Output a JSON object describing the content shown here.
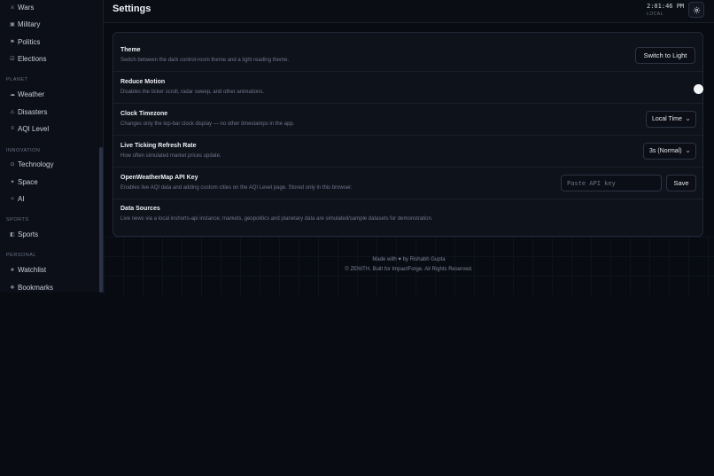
{
  "sidebar": {
    "items_top": [
      {
        "icon": "sword-icon",
        "glyph": "⚔",
        "label": "Wars"
      },
      {
        "icon": "military-icon",
        "glyph": "▣",
        "label": "Military"
      },
      {
        "icon": "flag-icon",
        "glyph": "⚑",
        "label": "Politics"
      },
      {
        "icon": "ballot-icon",
        "glyph": "☑",
        "label": "Elections"
      }
    ],
    "section_planet": "PLANET",
    "items_planet": [
      {
        "icon": "cloud-icon",
        "glyph": "☁",
        "label": "Weather"
      },
      {
        "icon": "warning-icon",
        "glyph": "⚠",
        "label": "Disasters"
      },
      {
        "icon": "wind-icon",
        "glyph": "≡",
        "label": "AQI Level"
      }
    ],
    "section_innovation": "INNOVATION",
    "items_innovation": [
      {
        "icon": "chip-icon",
        "glyph": "⊙",
        "label": "Technology"
      },
      {
        "icon": "rocket-icon",
        "glyph": "✦",
        "label": "Space"
      },
      {
        "icon": "sparkle-icon",
        "glyph": "✧",
        "label": "AI"
      }
    ],
    "section_sports": "SPORTS",
    "items_sports": [
      {
        "icon": "trophy-icon",
        "glyph": "◧",
        "label": "Sports"
      }
    ],
    "section_personal": "PERSONAL",
    "items_personal": [
      {
        "icon": "star-icon",
        "glyph": "★",
        "label": "Watchlist"
      },
      {
        "icon": "bookmark-icon",
        "glyph": "❖",
        "label": "Bookmarks"
      }
    ]
  },
  "header": {
    "title": "Settings",
    "clock": "2:01:46 PM",
    "clock_zone": "LOCAL",
    "settings_icon": "gear-icon"
  },
  "settings": {
    "theme": {
      "title": "Theme",
      "desc": "Switch between the dark control-room theme and a light reading theme.",
      "button": "Switch to Light"
    },
    "motion": {
      "title": "Reduce Motion",
      "desc": "Disables the ticker scroll, radar sweep, and other animations.",
      "enabled": false
    },
    "timezone": {
      "title": "Clock Timezone",
      "desc": "Changes only the top-bar clock display — no other timestamps in the app.",
      "selected": "Local Time"
    },
    "refresh": {
      "title": "Live Ticking Refresh Rate",
      "desc": "How often simulated market prices update.",
      "selected": "3s (Normal)"
    },
    "api": {
      "title": "OpenWeatherMap API Key",
      "desc": "Enables live AQI data and adding custom cities on the AQI Level page. Stored only in this browser.",
      "placeholder": "Paste API key",
      "button": "Save"
    },
    "sources": {
      "title": "Data Sources",
      "desc": "Live news via a local inshorts-api instance; markets, geopolitics and planetary data are simulated/sample datasets for demonstration."
    }
  },
  "footer": {
    "made_with": "Made with ♥ by Rishabh Gupta",
    "copyright": "© ZENITH. Built for ImpactForge. All Rights Reserved."
  },
  "colors": {
    "background": "#090b12",
    "panel": "#0e121b",
    "border": "#222837",
    "text": "#e6e8ee",
    "muted": "#6f778a"
  }
}
